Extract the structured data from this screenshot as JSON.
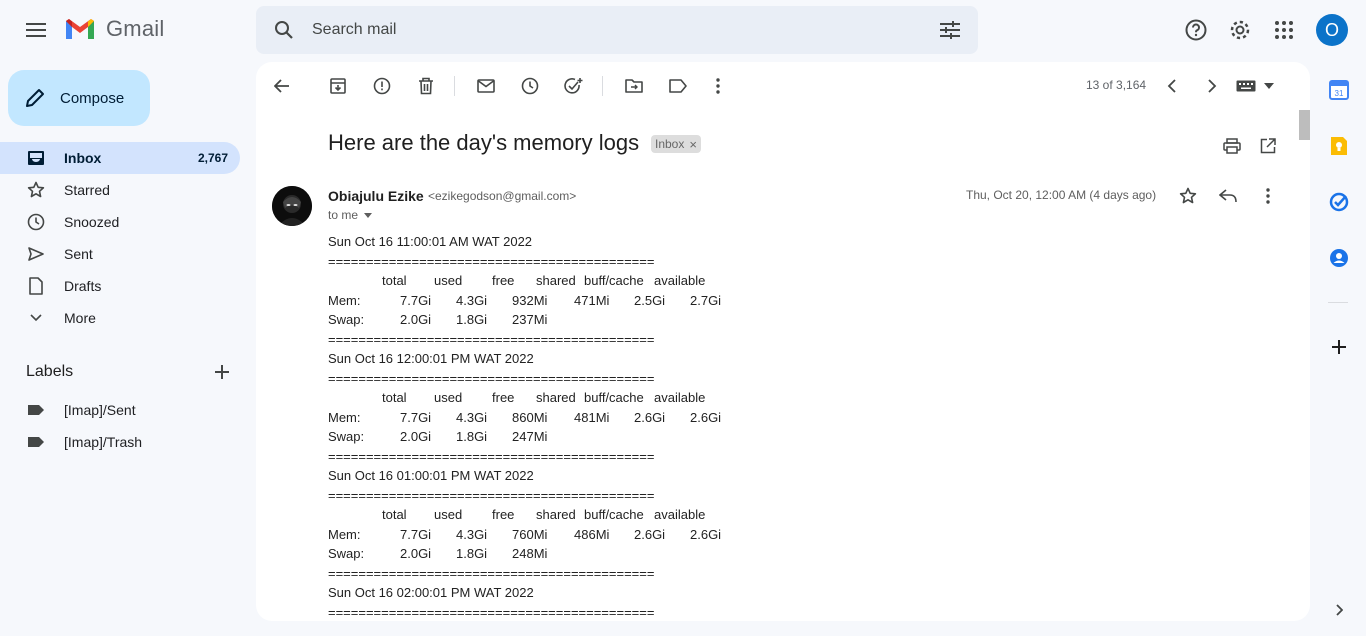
{
  "app": {
    "name": "Gmail"
  },
  "search": {
    "placeholder": "Search mail"
  },
  "top_icons": [
    "support-icon",
    "settings-icon",
    "apps-icon"
  ],
  "account": {
    "initial": "O",
    "color": "#0b73c9"
  },
  "compose": {
    "label": "Compose"
  },
  "nav": [
    {
      "label": "Inbox",
      "count": "2,767",
      "icon": "inbox-icon",
      "active": true
    },
    {
      "label": "Starred",
      "count": "",
      "icon": "star-icon"
    },
    {
      "label": "Snoozed",
      "count": "",
      "icon": "clock-icon"
    },
    {
      "label": "Sent",
      "count": "",
      "icon": "send-icon"
    },
    {
      "label": "Drafts",
      "count": "",
      "icon": "draft-icon"
    },
    {
      "label": "More",
      "count": "",
      "icon": "chevron-down-icon"
    }
  ],
  "labels": {
    "title": "Labels",
    "items": [
      {
        "label": "[Imap]/Sent",
        "icon": "label-icon"
      },
      {
        "label": "[Imap]/Trash",
        "icon": "label-icon"
      }
    ]
  },
  "toolbar": {
    "pager": "13 of 3,164"
  },
  "email": {
    "subject": "Here are the day's memory logs",
    "chip": "Inbox",
    "sender_name": "Obiajulu Ezike",
    "sender_email": "<ezikegodson@gmail.com>",
    "to": "to me",
    "date": "Thu, Oct 20, 12:00 AM (4 days ago)",
    "body": [
      {
        "type": "text",
        "text": "Sun Oct 16 11:00:01 AM WAT 2022"
      },
      {
        "type": "text",
        "text": "==========================================="
      },
      {
        "type": "header",
        "cells": [
          "total",
          "used",
          "free",
          "shared",
          "buff/cache",
          "available"
        ]
      },
      {
        "type": "row",
        "cells": [
          "Mem:",
          "7.7Gi",
          "4.3Gi",
          "932Mi",
          "471Mi",
          "2.5Gi",
          "2.7Gi"
        ]
      },
      {
        "type": "row",
        "cells": [
          "Swap:",
          "2.0Gi",
          "1.8Gi",
          "237Mi"
        ]
      },
      {
        "type": "text",
        "text": "==========================================="
      },
      {
        "type": "text",
        "text": "Sun Oct 16 12:00:01 PM WAT 2022"
      },
      {
        "type": "text",
        "text": "==========================================="
      },
      {
        "type": "header",
        "cells": [
          "total",
          "used",
          "free",
          "shared",
          "buff/cache",
          "available"
        ]
      },
      {
        "type": "row",
        "cells": [
          "Mem:",
          "7.7Gi",
          "4.3Gi",
          "860Mi",
          "481Mi",
          "2.6Gi",
          "2.6Gi"
        ]
      },
      {
        "type": "row",
        "cells": [
          "Swap:",
          "2.0Gi",
          "1.8Gi",
          "247Mi"
        ]
      },
      {
        "type": "text",
        "text": "==========================================="
      },
      {
        "type": "text",
        "text": "Sun Oct 16 01:00:01 PM WAT 2022"
      },
      {
        "type": "text",
        "text": "==========================================="
      },
      {
        "type": "header",
        "cells": [
          "total",
          "used",
          "free",
          "shared",
          "buff/cache",
          "available"
        ]
      },
      {
        "type": "row",
        "cells": [
          "Mem:",
          "7.7Gi",
          "4.3Gi",
          "760Mi",
          "486Mi",
          "2.6Gi",
          "2.6Gi"
        ]
      },
      {
        "type": "row",
        "cells": [
          "Swap:",
          "2.0Gi",
          "1.8Gi",
          "248Mi"
        ]
      },
      {
        "type": "text",
        "text": "==========================================="
      },
      {
        "type": "text",
        "text": "Sun Oct 16 02:00:01 PM WAT 2022"
      },
      {
        "type": "text",
        "text": "==========================================="
      }
    ]
  },
  "side_panel": [
    "calendar-icon",
    "keep-icon",
    "tasks-icon",
    "contacts-icon",
    "add-icon",
    "expand-icon"
  ],
  "colors": {
    "accent": "#0b57d0",
    "active_nav": "#d3e3fd",
    "compose": "#c2e7ff"
  }
}
